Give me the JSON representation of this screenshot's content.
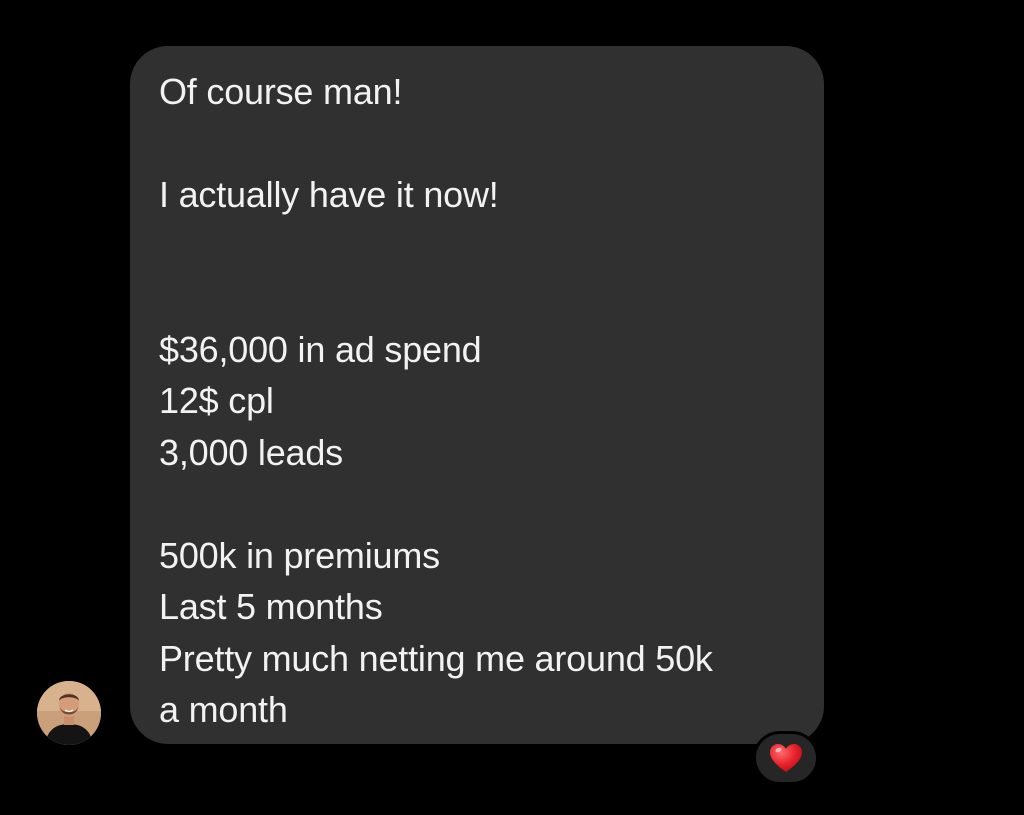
{
  "message": {
    "lines": [
      "Of course man!",
      "",
      "I actually have it now!",
      "",
      "",
      "$36,000 in ad spend",
      "12$ cpl",
      "3,000 leads",
      "",
      "500k in premiums",
      "Last 5 months",
      "Pretty much netting me around 50k",
      "a month"
    ]
  },
  "reaction": {
    "icon": "heart-icon",
    "color": "#e8202a"
  },
  "sender": {
    "avatar": "avatar"
  },
  "colors": {
    "background": "#000000",
    "bubble": "#303030",
    "text": "#f2f2f2"
  }
}
